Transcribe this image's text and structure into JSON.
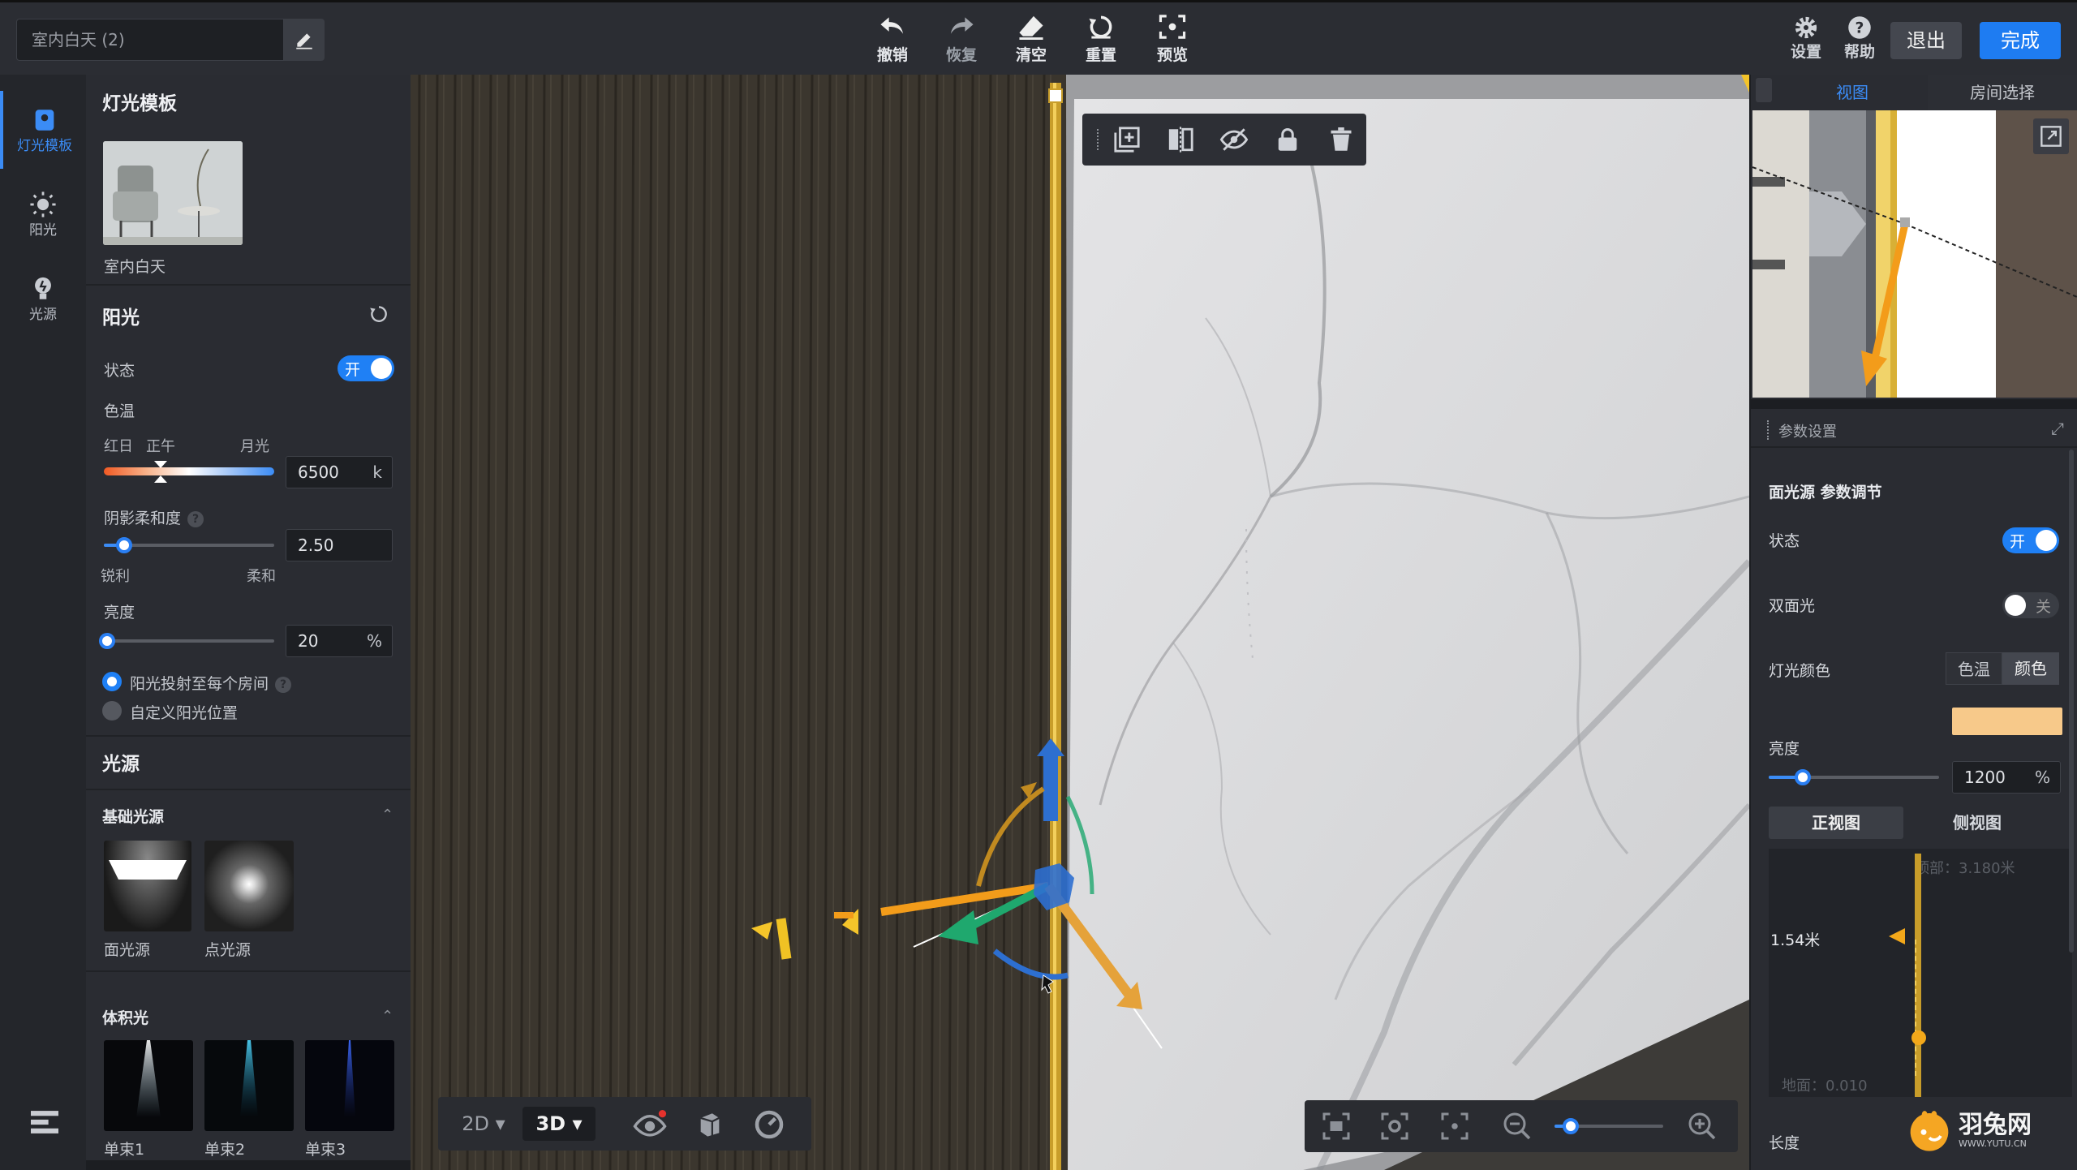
{
  "topbar": {
    "scene_name": "室内白天 (2)",
    "tools": [
      {
        "label": "撤销"
      },
      {
        "label": "恢复"
      },
      {
        "label": "清空"
      },
      {
        "label": "重置"
      },
      {
        "label": "预览"
      }
    ],
    "settings_label": "设置",
    "help_label": "帮助",
    "exit_label": "退出",
    "done_label": "完成"
  },
  "leftnav": {
    "items": [
      {
        "label": "灯光模板",
        "icon": "lamp-template-icon"
      },
      {
        "label": "阳光",
        "icon": "sun-icon"
      },
      {
        "label": "光源",
        "icon": "bulb-icon"
      }
    ]
  },
  "panel": {
    "template_title": "灯光模板",
    "template_name": "室内白天",
    "sunlight_title": "阳光",
    "status_label": "状态",
    "status_toggle": "开",
    "color_temp_label": "色温",
    "ct_left": "红日",
    "ct_mid": "正午",
    "ct_right": "月光",
    "ct_value": "6500",
    "ct_unit": "k",
    "shadow_label": "阴影柔和度",
    "shadow_value": "2.50",
    "shadow_left": "锐利",
    "shadow_right": "柔和",
    "shadow_level": 0.12,
    "brightness_label": "亮度",
    "brightness_value": "20",
    "brightness_unit": "%",
    "brightness_level": 0.02,
    "radio1": "阳光投射至每个房间",
    "radio2": "自定义阳光位置",
    "lights_title": "光源",
    "basic_title": "基础光源",
    "basic_items": [
      {
        "label": "面光源"
      },
      {
        "label": "点光源"
      }
    ],
    "volume_title": "体积光",
    "volume_items": [
      {
        "label": "单束1"
      },
      {
        "label": "单束2"
      },
      {
        "label": "单束3"
      }
    ]
  },
  "canvas": {
    "view_2d": "2D",
    "view_3d": "3D",
    "zoom_level": 0.15
  },
  "rpanel": {
    "tab_view": "视图",
    "tab_room": "房间选择",
    "params_title": "参数设置",
    "section_title": "面光源 参数调节",
    "status_label": "状态",
    "status_toggle": "开",
    "double_label": "双面光",
    "double_toggle": "关",
    "color_label": "灯光颜色",
    "color_seg1": "色温",
    "color_seg2": "颜色",
    "swatch_color": "#f7c98a",
    "brightness_label": "亮度",
    "brightness_value": "1200",
    "brightness_unit": "%",
    "brightness_level": 0.2,
    "view_front": "正视图",
    "view_side": "侧视图",
    "top_label": "顶部：3.180米",
    "height_label": "1.54米",
    "ground_label": "地面：0.010",
    "length_label": "长度"
  },
  "logo": {
    "name": "羽兔网",
    "url_text": "WWW.YUTU.CN"
  }
}
